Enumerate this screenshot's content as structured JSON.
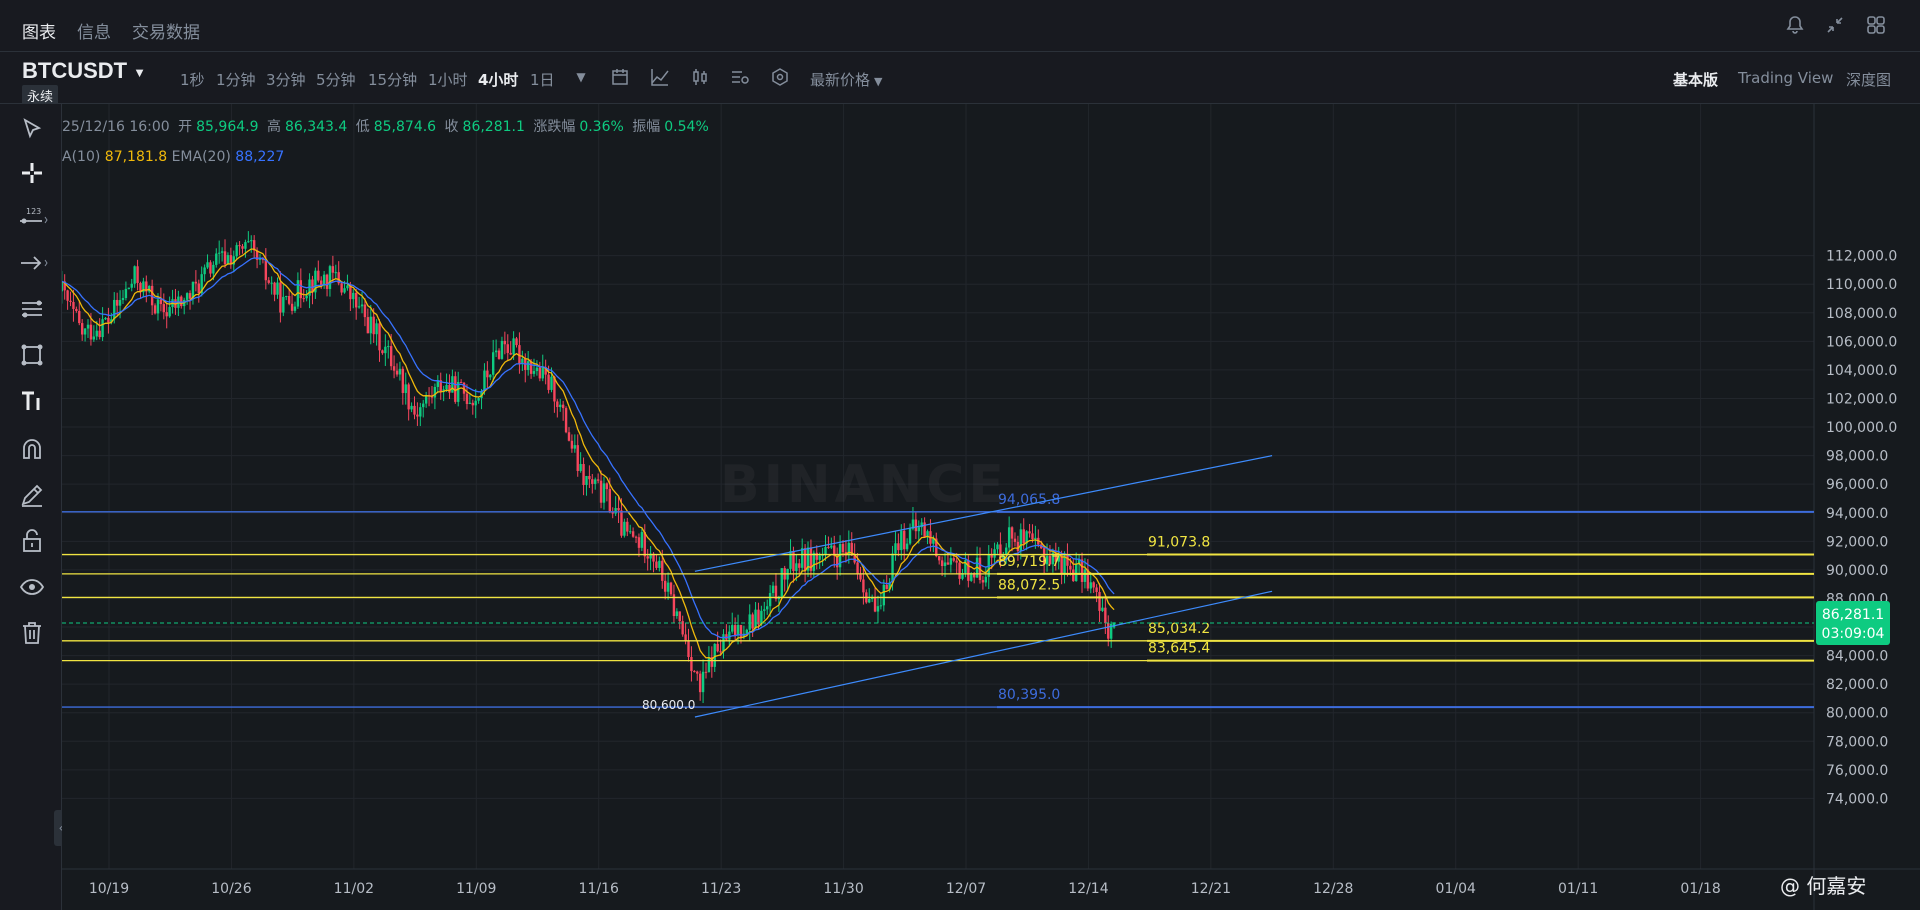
{
  "nav": {
    "tabs": [
      "图表",
      "信息",
      "交易数据"
    ],
    "icons": [
      "bell-icon",
      "collapse-arrows-icon",
      "grid-layout-icon"
    ]
  },
  "toolbar": {
    "symbol": "BTCUSDT",
    "contract": "永续",
    "intervals": [
      "1秒",
      "1分钟",
      "3分钟",
      "5分钟",
      "15分钟",
      "1小时",
      "4小时",
      "1日"
    ],
    "active_interval": "4小时",
    "price_type": "最新价格",
    "modes": [
      "基本版",
      "Trading View",
      "深度图"
    ],
    "active_mode": "基本版"
  },
  "ohlc": {
    "datetime": "25/12/16 16:00",
    "open_label": "开",
    "open": "85,964.9",
    "high_label": "高",
    "high": "86,343.4",
    "low_label": "低",
    "low": "85,874.6",
    "close_label": "收",
    "close": "86,281.1",
    "change_label": "涨跌幅",
    "change": "0.36%",
    "amplitude_label": "振幅",
    "amplitude": "0.54%"
  },
  "ema": {
    "ema10_label": "A(10)",
    "ema10": "87,181.8",
    "ema20_label": "EMA(20)",
    "ema20": "88,227"
  },
  "sidebar_tools": [
    "cursor-icon",
    "crosshair-icon",
    "price-label-icon",
    "arrow-right-icon",
    "fib-lines-icon",
    "pattern-icon",
    "text-tool-icon",
    "magnet-icon",
    "pencil-icon",
    "lock-icon",
    "eye-icon",
    "trash-icon"
  ],
  "watermark": "BINANCE",
  "credit": "@ 何嘉安",
  "colors": {
    "up": "#0ecb81",
    "down": "#f6465d",
    "ema10": "#f0b90b",
    "ema20": "#3772ff",
    "hline_yellow": "#f0e442",
    "hline_blue": "#3d6cdc",
    "price_tag": "#0ecb81"
  },
  "chart_data": {
    "type": "candlestick",
    "timeframe": "4h",
    "ylim": [
      72600,
      113600
    ],
    "y_ticks": [
      "74,000.0",
      "76,000.0",
      "78,000.0",
      "80,000.0",
      "82,000.0",
      "84,000.0",
      "86,000.0",
      "88,000.0",
      "90,000.0",
      "92,000.0",
      "94,000.0",
      "96,000.0",
      "98,000.0",
      "100,000.0",
      "102,000.0",
      "104,000.0",
      "106,000.0",
      "108,000.0",
      "110,000.0",
      "112,000.0"
    ],
    "x_ticks": [
      "10/19",
      "10/26",
      "11/02",
      "11/09",
      "11/16",
      "11/23",
      "11/30",
      "12/07",
      "12/14",
      "12/21",
      "12/28",
      "01/04",
      "01/11",
      "01/18"
    ],
    "x_tick_days": [
      0,
      7,
      14,
      21,
      28,
      35,
      42,
      49,
      56,
      63,
      70,
      77,
      84,
      91
    ],
    "approx_close_path": [
      {
        "day": -2.7,
        "close": 109500
      },
      {
        "day": -1.5,
        "close": 106500
      },
      {
        "day": 0,
        "close": 107500
      },
      {
        "day": 1.5,
        "close": 110500
      },
      {
        "day": 3,
        "close": 108000
      },
      {
        "day": 4.5,
        "close": 109000
      },
      {
        "day": 6,
        "close": 111500
      },
      {
        "day": 8,
        "close": 112500
      },
      {
        "day": 10,
        "close": 108500
      },
      {
        "day": 11.5,
        "close": 110200
      },
      {
        "day": 13,
        "close": 110500
      },
      {
        "day": 15,
        "close": 107000
      },
      {
        "day": 16.5,
        "close": 104000
      },
      {
        "day": 17.5,
        "close": 101000
      },
      {
        "day": 19,
        "close": 103000
      },
      {
        "day": 21,
        "close": 102000
      },
      {
        "day": 22.5,
        "close": 106000
      },
      {
        "day": 24,
        "close": 104500
      },
      {
        "day": 25.5,
        "close": 102500
      },
      {
        "day": 27,
        "close": 96500
      },
      {
        "day": 28.5,
        "close": 95000
      },
      {
        "day": 29.5,
        "close": 92500
      },
      {
        "day": 31,
        "close": 91500
      },
      {
        "day": 33,
        "close": 85000
      },
      {
        "day": 33.8,
        "close": 81500
      },
      {
        "day": 34.5,
        "close": 84000
      },
      {
        "day": 36,
        "close": 86000
      },
      {
        "day": 37.5,
        "close": 87000
      },
      {
        "day": 39,
        "close": 90500
      },
      {
        "day": 41,
        "close": 91000
      },
      {
        "day": 42.5,
        "close": 91000
      },
      {
        "day": 44,
        "close": 86500
      },
      {
        "day": 45,
        "close": 92000
      },
      {
        "day": 46.5,
        "close": 93000
      },
      {
        "day": 48,
        "close": 90000
      },
      {
        "day": 50,
        "close": 90000
      },
      {
        "day": 51.5,
        "close": 92500
      },
      {
        "day": 53,
        "close": 91500
      },
      {
        "day": 54.5,
        "close": 90500
      },
      {
        "day": 56,
        "close": 89500
      },
      {
        "day": 57,
        "close": 86000
      },
      {
        "day": 57.5,
        "close": 86281.1
      }
    ],
    "horizontal_lines": [
      {
        "price": 94065.8,
        "label": "94,065.8",
        "color": "blue"
      },
      {
        "price": 91073.8,
        "label": "91,073.8",
        "color": "yellow"
      },
      {
        "price": 89719.7,
        "label": "89,719.7",
        "color": "yellow"
      },
      {
        "price": 88072.5,
        "label": "88,072.5",
        "color": "yellow"
      },
      {
        "price": 85034.2,
        "label": "85,034.2",
        "color": "yellow"
      },
      {
        "price": 83645.4,
        "label": "83,645.4",
        "color": "yellow"
      },
      {
        "price": 80395.0,
        "label": "80,395.0",
        "color": "blue"
      }
    ],
    "channel": {
      "lower": [
        {
          "day": 33.5,
          "price": 79700
        },
        {
          "day": 66.5,
          "price": 88500
        }
      ],
      "upper": [
        {
          "day": 33.5,
          "price": 89900
        },
        {
          "day": 66.5,
          "price": 98000
        }
      ]
    },
    "low_marker": {
      "day": 34.5,
      "price": 80600.0,
      "label": "80,600.0"
    },
    "last_price": {
      "value": "86,281.1",
      "countdown": "03:09:04",
      "price": 86281.1
    }
  }
}
